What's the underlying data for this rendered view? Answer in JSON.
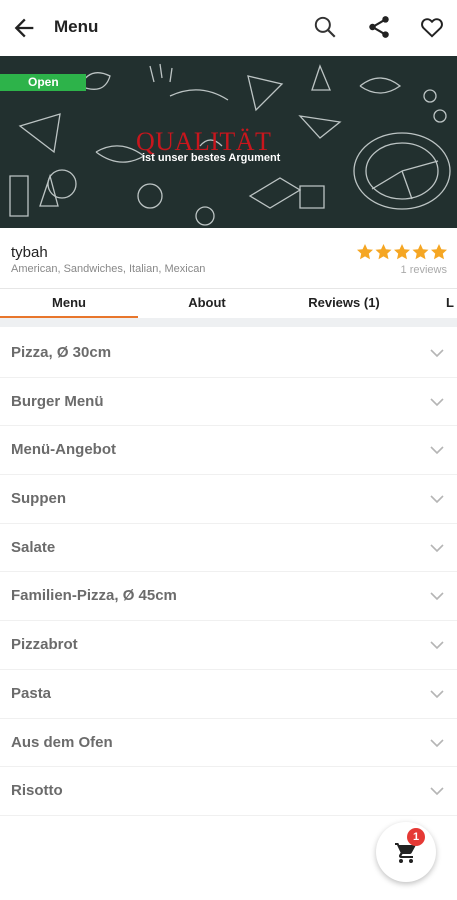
{
  "header": {
    "title": "Menu"
  },
  "hero": {
    "status_badge": "Open",
    "headline": "QUALITÄT",
    "subline": "ist unser bestes Argument"
  },
  "restaurant": {
    "name": "tybah",
    "cuisines": "American, Sandwiches, Italian, Mexican",
    "rating": 5,
    "reviews_text": "1 reviews"
  },
  "tabs": [
    {
      "label": "Menu",
      "active": true
    },
    {
      "label": "About",
      "active": false
    },
    {
      "label": "Reviews (1)",
      "active": false
    },
    {
      "label": "L",
      "active": false
    }
  ],
  "categories": [
    "Pizza, Ø 30cm",
    "Burger Menü",
    "Menü-Angebot",
    "Suppen",
    "Salate",
    "Familien-Pizza, Ø 45cm",
    "Pizzabrot",
    "Pasta",
    "Aus dem Ofen",
    "Risotto"
  ],
  "cart": {
    "count": "1",
    "icon": "cart-icon"
  },
  "icons": {
    "back": "back-arrow-icon",
    "search": "search-icon",
    "share": "share-icon",
    "favorite": "heart-icon"
  },
  "colors": {
    "accent": "#e8762c",
    "open_badge": "#2db34a",
    "star": "#f5a623",
    "cart_badge": "#e53935"
  }
}
